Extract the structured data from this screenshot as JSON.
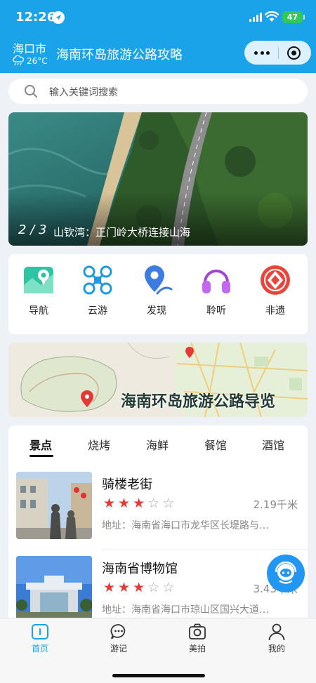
{
  "status_bar": {
    "time": "12:26",
    "battery": "47"
  },
  "header": {
    "city": "海口市",
    "temperature": "26°C",
    "title": "海南环岛旅游公路攻略"
  },
  "search": {
    "placeholder": "输入关键词搜索"
  },
  "banner": {
    "index": "2 / 3",
    "caption": "山钦湾：正门岭大桥连接山海"
  },
  "quick_nav": [
    {
      "label": "导航",
      "icon": "map-navigation-icon"
    },
    {
      "label": "云游",
      "icon": "drone-icon"
    },
    {
      "label": "发现",
      "icon": "location-pin-icon"
    },
    {
      "label": "聆听",
      "icon": "headphones-icon"
    },
    {
      "label": "非遗",
      "icon": "heritage-icon"
    }
  ],
  "map_banner": {
    "title": "海南环岛旅游公路导览"
  },
  "category_tabs": [
    "景点",
    "烧烤",
    "海鲜",
    "餐馆",
    "酒馆"
  ],
  "active_tab": "景点",
  "places": [
    {
      "name": "骑楼老街",
      "rating": 3,
      "max_rating": 5,
      "distance": "2.19千米",
      "address": "地址：海南省海口市龙华区长堤路与…"
    },
    {
      "name": "海南省博物馆",
      "rating": 3,
      "max_rating": 5,
      "distance": "3.43千米",
      "address": "地址：海南省海口市琼山区国兴大道…"
    }
  ],
  "tab_bar": [
    {
      "label": "首页",
      "icon": "home-icon",
      "active": true
    },
    {
      "label": "游记",
      "icon": "chat-icon",
      "active": false
    },
    {
      "label": "美拍",
      "icon": "camera-icon",
      "active": false
    },
    {
      "label": "我的",
      "icon": "user-icon",
      "active": false
    }
  ],
  "colors": {
    "primary": "#1aa3e8",
    "star": "#e53935",
    "fab": "#2196f3"
  }
}
